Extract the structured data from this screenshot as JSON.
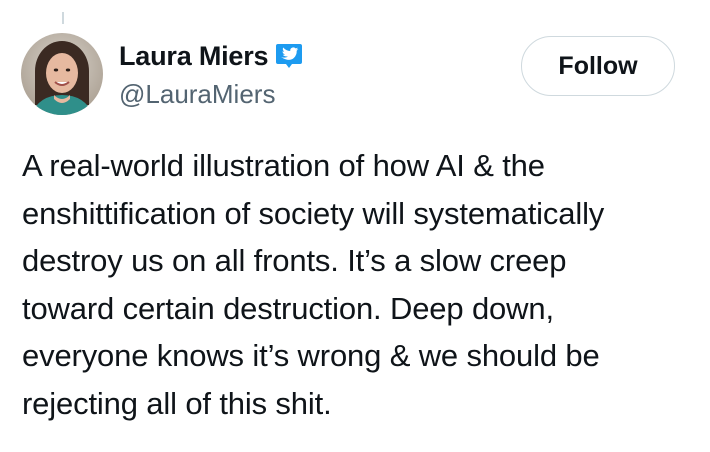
{
  "author": {
    "display_name": "Laura Miers",
    "handle": "@LauraMiers",
    "verified": true,
    "avatar_icon": "profile-photo"
  },
  "actions": {
    "follow_label": "Follow"
  },
  "tweet": {
    "text": "A real-world illustration of how AI & the\nenshittification of society will systematically\ndestroy us on all fronts. It’s a slow creep\ntoward certain destruction. Deep down,\neveryone knows it’s wrong & we should be\nrejecting all of this shit."
  },
  "colors": {
    "verified_badge": "#1d9bf0",
    "text_primary": "#0f1419",
    "text_secondary": "#536471",
    "border": "#cfd9de"
  }
}
